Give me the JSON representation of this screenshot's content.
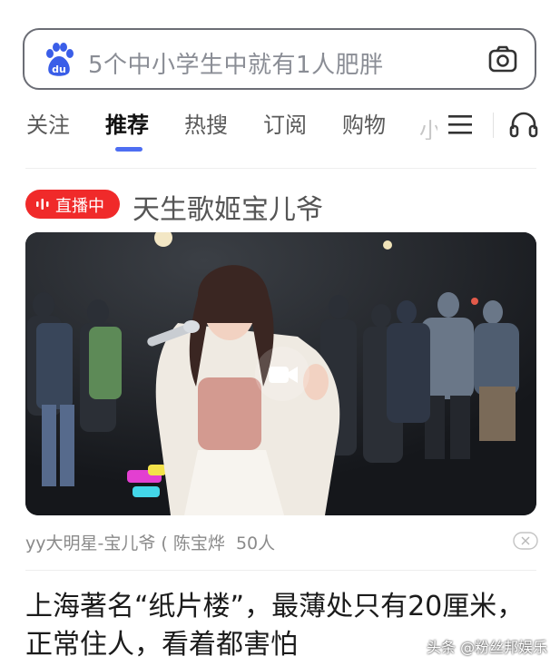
{
  "search": {
    "placeholder": "5个中小学生中就有1人肥胖",
    "logo_icon": "baidu-paw-logo",
    "camera_icon": "camera-icon"
  },
  "tabs": [
    {
      "label": "关注",
      "active": false
    },
    {
      "label": "推荐",
      "active": true
    },
    {
      "label": "热搜",
      "active": false
    },
    {
      "label": "订阅",
      "active": false
    },
    {
      "label": "购物",
      "active": false
    }
  ],
  "tab_fade_char": "小",
  "icons": {
    "menu": "hamburger-menu-icon",
    "audio": "headset-icon"
  },
  "feed": {
    "live": {
      "badge": "直播中",
      "title": "天生歌姬宝儿爷"
    },
    "video": {
      "overlay_icon": "video-camera-icon"
    },
    "source": "yy大明星-宝儿爷 ( 陈宝烨",
    "viewers": "50人",
    "news_title": "上海著名“纸片楼”，最薄处只有20厘米，正常住人，看着都害怕"
  },
  "watermark": "头条 @粉丝邦娱乐",
  "colors": {
    "accent": "#4e6ef2",
    "live": "#f02a2a",
    "brand_blue": "#3a5ee8"
  }
}
